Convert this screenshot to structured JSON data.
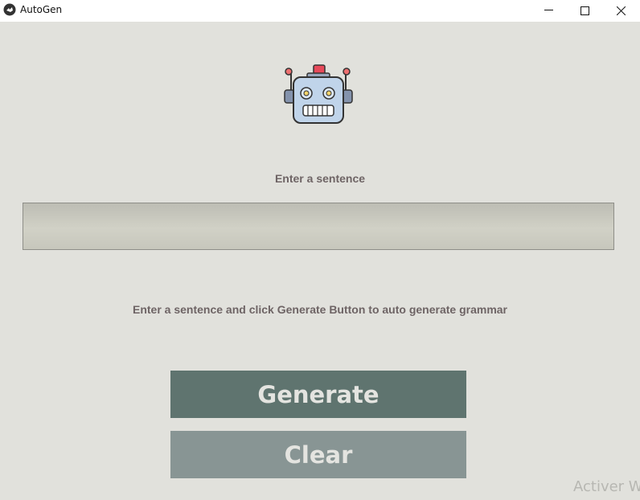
{
  "window": {
    "title": "AutoGen",
    "app_icon": "kivy-logo-icon",
    "controls": [
      "minimize-icon",
      "maximize-icon",
      "close-icon"
    ]
  },
  "main": {
    "logo_icon": "robot-icon",
    "prompt_label": "Enter a sentence",
    "input": {
      "value": "",
      "placeholder": ""
    },
    "hint": "Enter a sentence and click Generate Button to auto generate grammar",
    "generate_label": "Generate",
    "clear_label": "Clear"
  },
  "overlay": {
    "watermark": "Activer W"
  },
  "colors": {
    "background": "#e1e1dc",
    "generate_button": "#5f746f",
    "clear_button": "#889594",
    "label_text": "#6e6465"
  }
}
